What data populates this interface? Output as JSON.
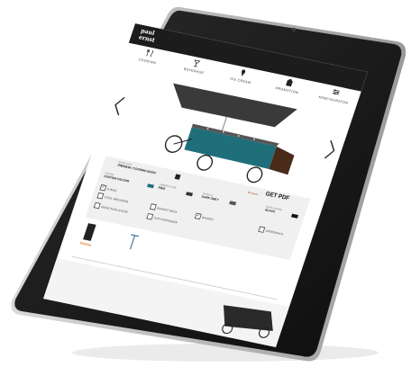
{
  "brand": {
    "logo_line1": "paul",
    "logo_line2": "ernst"
  },
  "top_nav": [
    "",
    "",
    "",
    "",
    ""
  ],
  "categories": [
    {
      "label": "COOKING",
      "icon": "cooking-icon"
    },
    {
      "label": "BEVERAGE",
      "icon": "beverage-icon"
    },
    {
      "label": "ICE CREAM",
      "icon": "ice-cream-icon"
    },
    {
      "label": "PROMOTION",
      "icon": "promotion-icon"
    },
    {
      "label": "KONFIGURATOR",
      "icon": "konfigurator-icon"
    }
  ],
  "config": {
    "main_unit": {
      "caption": "MAIN UNIT",
      "value": "PREMIUM / COOKING BASIC"
    },
    "frame": {
      "caption": "FRAME",
      "value": "CUSTOM COLOUR"
    },
    "umbrella": {
      "caption": "UMBRELATHE",
      "value": "KING"
    },
    "handle": {
      "caption": "HANDLE",
      "value": "DARK GREY"
    },
    "bike_frame": {
      "caption": "BIKE FRAME",
      "value": "BLACK"
    },
    "saved_label": "❤ Saved",
    "pdf_label": "GET PDF",
    "options": [
      {
        "label": "E-BIKE",
        "checked": true
      },
      {
        "label": "COOL REGISTER",
        "checked": false
      },
      {
        "label": "BASKET DECK",
        "checked": false
      },
      {
        "label": "BASKET",
        "checked": true
      },
      {
        "label": "SPEEDRACK",
        "checked": false
      },
      {
        "label": "INDUCTION STOVE",
        "checked": false
      },
      {
        "label": "CUP DISPENSER",
        "checked": false
      }
    ],
    "accessories": [
      {
        "label": "Kitchen"
      },
      {
        "label": ""
      }
    ]
  },
  "colors": {
    "cart_teal": "#1f6f7a",
    "cart_top": "#3a3a3a",
    "screen_dark": "#1c1c1c",
    "accent_orange": "#e07b1a"
  }
}
